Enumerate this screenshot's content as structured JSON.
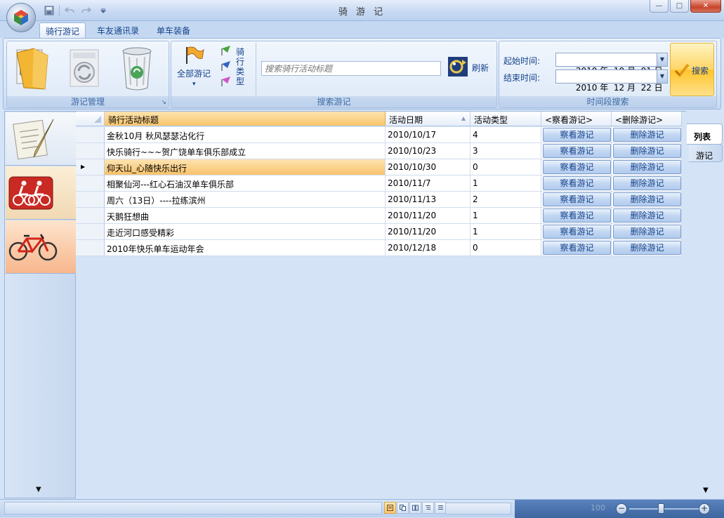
{
  "window": {
    "title": "骑 游 记",
    "min_glyph": "—",
    "max_glyph": "□",
    "close_glyph": "✕"
  },
  "ribbon_tabs": [
    {
      "label": "骑行游记",
      "active": true
    },
    {
      "label": "车友通讯录",
      "active": false
    },
    {
      "label": "单车装备",
      "active": false
    }
  ],
  "groups": {
    "manage": {
      "label": "游记管理",
      "launcher": "↘"
    },
    "search": {
      "label": "搜索游记",
      "all_trips": "全部游记",
      "all_trips_arrow": "▾",
      "trip_type_label": "骑行类型",
      "search_placeholder": "搜索骑行活动标题",
      "refresh": "刷新"
    },
    "period": {
      "label": "时间段搜索",
      "start_label": "起始时间:",
      "start_value": "2010 年  10 月  01 日",
      "end_label": "结束时间:",
      "end_value": "2010 年  12 月  22 日",
      "search_button": "搜索",
      "drop_glyph": "▼"
    }
  },
  "grid": {
    "columns": [
      "骑行活动标题",
      "活动日期",
      "活动类型",
      "<察看游记>",
      "<删除游记>"
    ],
    "sort_glyph": "▲",
    "current_glyph": "▶",
    "rows": [
      {
        "title": "金秋10月 秋风瑟瑟沾化行",
        "date": "2010/10/17",
        "type": "4",
        "view": "察看游记",
        "delete": "删除游记"
      },
      {
        "title": "快乐骑行~~~贺广饶单车俱乐部成立",
        "date": "2010/10/23",
        "type": "3",
        "view": "察看游记",
        "delete": "删除游记"
      },
      {
        "title": "仰天山_心随快乐出行",
        "date": "2010/10/30",
        "type": "0",
        "view": "察看游记",
        "delete": "删除游记",
        "current": true
      },
      {
        "title": "相聚仙河---红心石油汉单车俱乐部",
        "date": "2010/11/7",
        "type": "1",
        "view": "察看游记",
        "delete": "删除游记"
      },
      {
        "title": "周六（13日）----拉练滨州",
        "date": "2010/11/13",
        "type": "2",
        "view": "察看游记",
        "delete": "删除游记"
      },
      {
        "title": "天鹅狂想曲",
        "date": "2010/11/20",
        "type": "1",
        "view": "察看游记",
        "delete": "删除游记"
      },
      {
        "title": "走近河口感受精彩",
        "date": "2010/11/20",
        "type": "1",
        "view": "察看游记",
        "delete": "删除游记"
      },
      {
        "title": "2010年快乐单车运动年会",
        "date": "2010/12/18",
        "type": "0",
        "view": "察看游记",
        "delete": "删除游记"
      }
    ]
  },
  "right_tabs": [
    {
      "label": "列表",
      "active": true
    },
    {
      "label": "游记",
      "active": false
    }
  ],
  "scroll_down_glyph": "▼",
  "status": {
    "zoom": "100",
    "zoom_minus": "−",
    "zoom_plus": "+"
  }
}
